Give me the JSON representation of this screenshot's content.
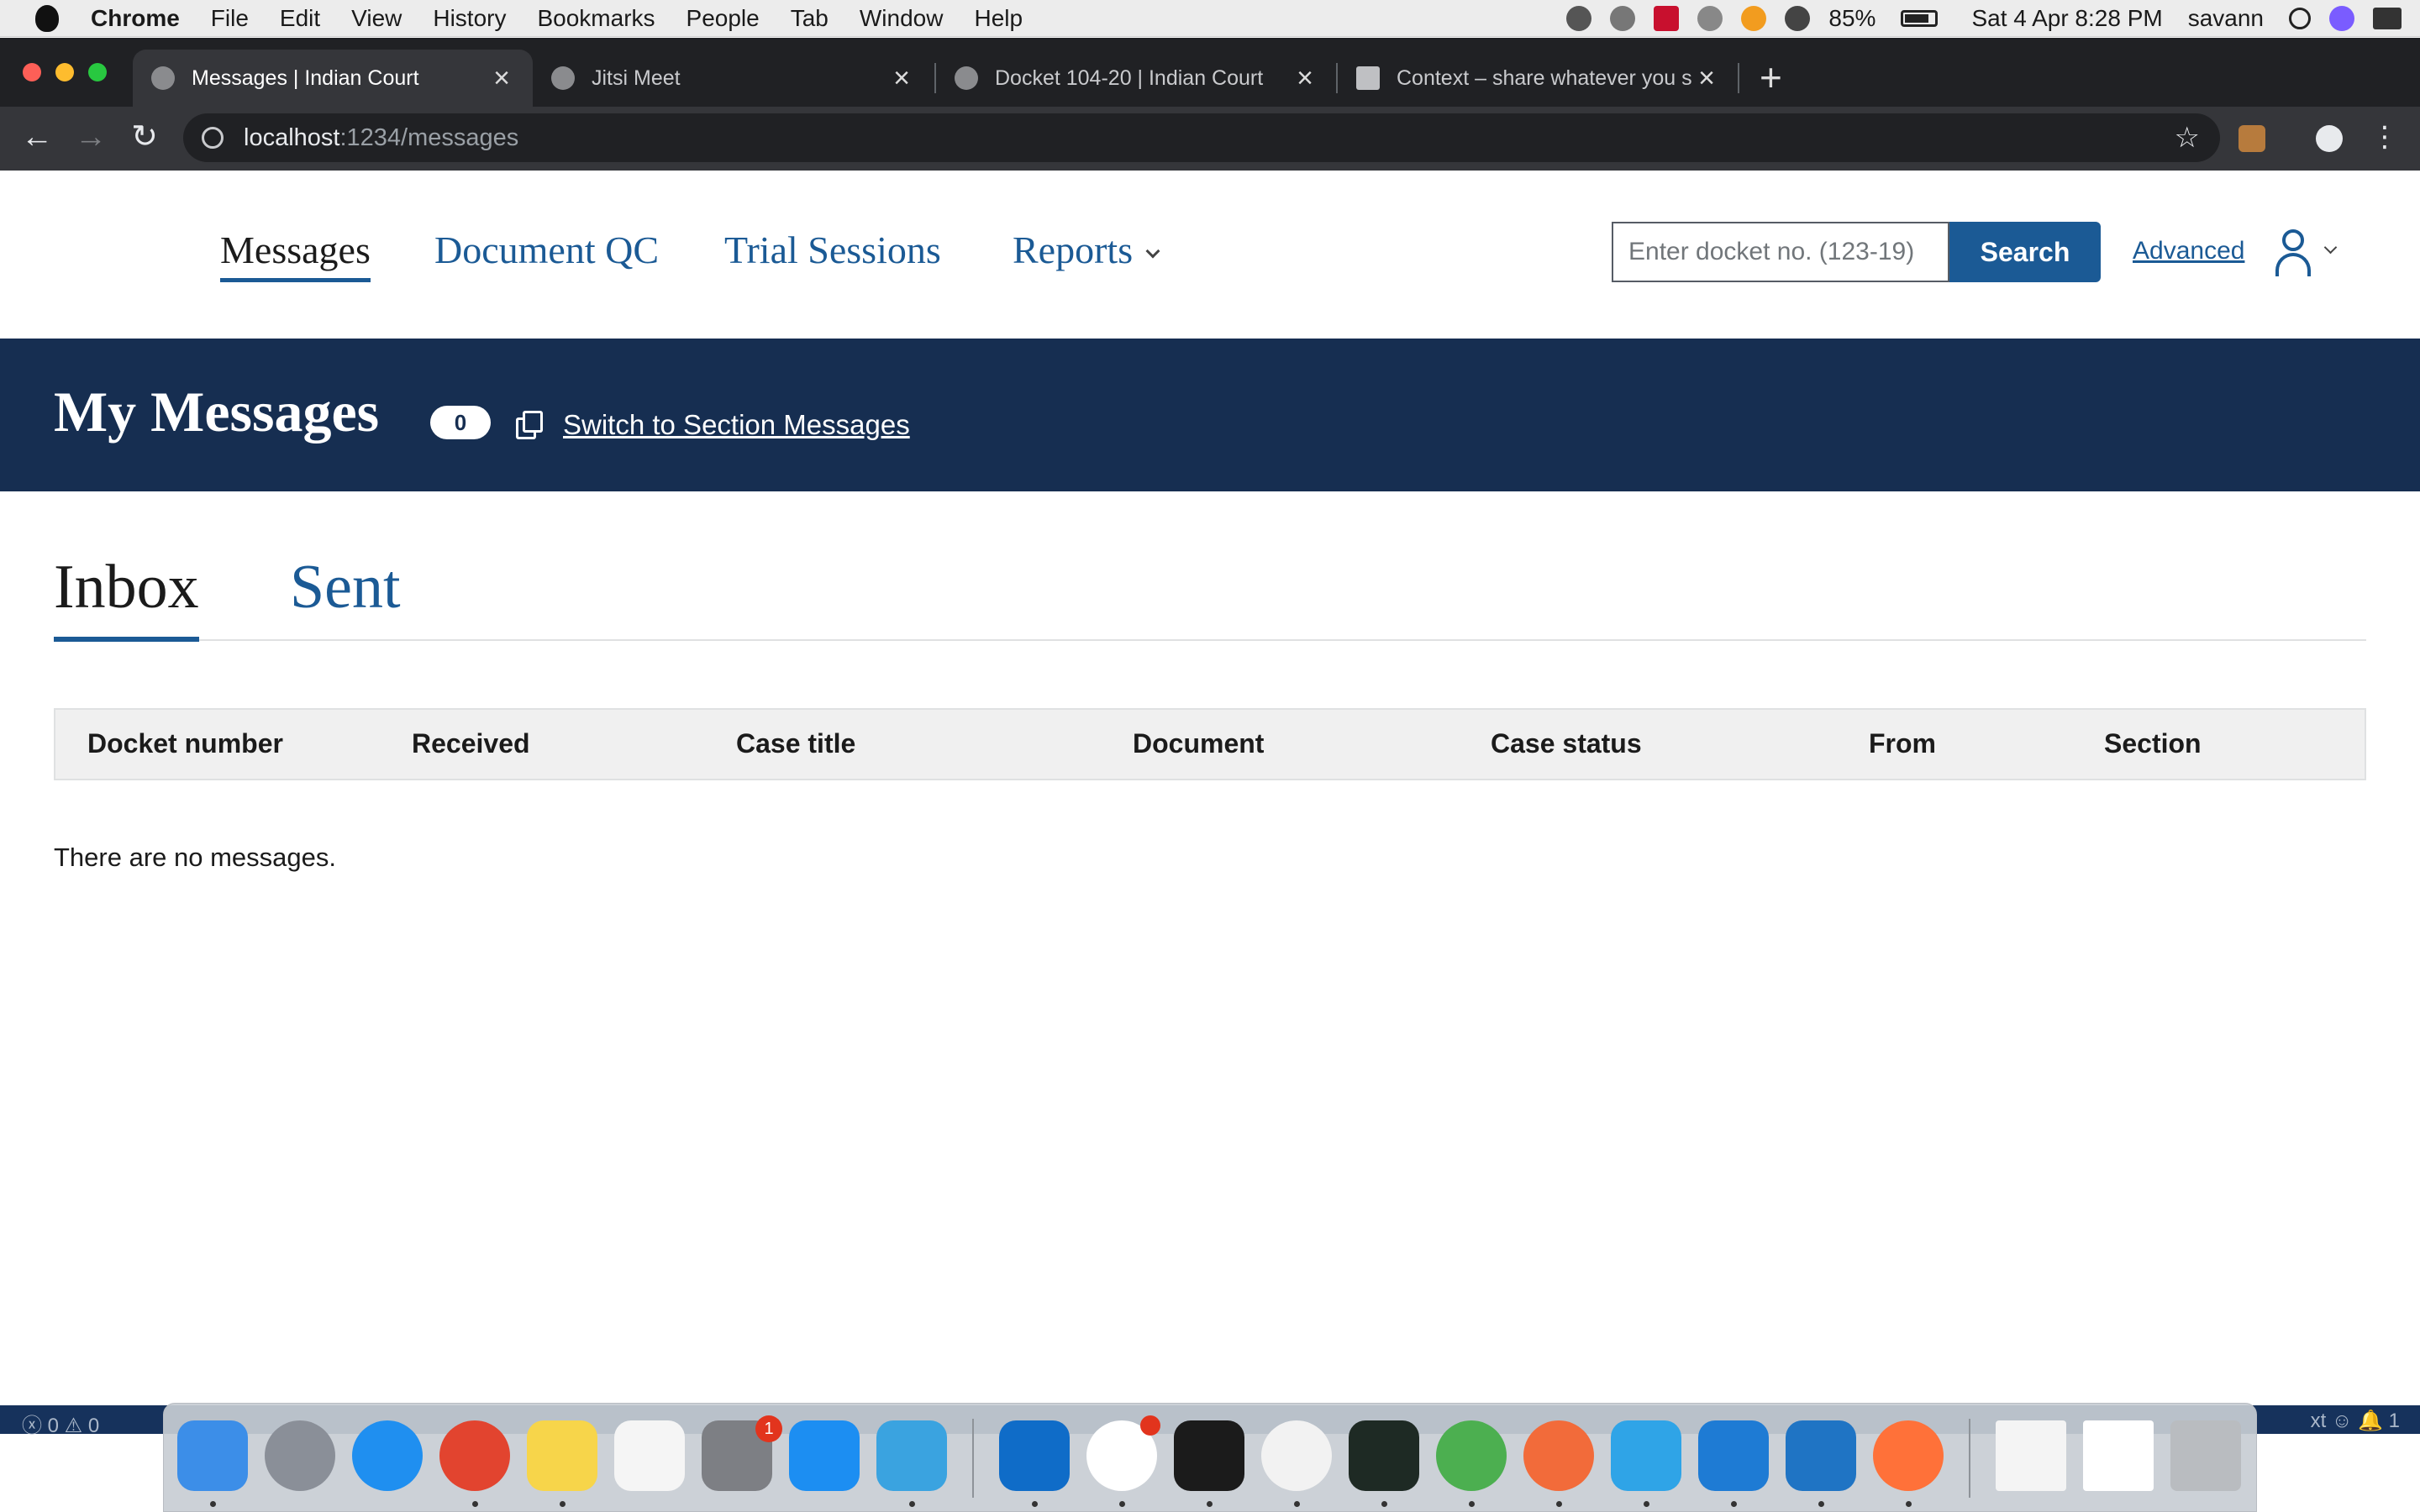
{
  "menubar": {
    "app_name": "Chrome",
    "items": [
      "File",
      "Edit",
      "View",
      "History",
      "Bookmarks",
      "People",
      "Tab",
      "Window",
      "Help"
    ],
    "battery": "85%",
    "datetime": "Sat 4 Apr  8:28 PM",
    "user": "savann"
  },
  "browser": {
    "tabs": [
      {
        "title": "Messages | Indian Court",
        "active": true
      },
      {
        "title": "Jitsi Meet",
        "active": false
      },
      {
        "title": "Docket 104-20 | Indian Court",
        "active": false
      },
      {
        "title": "Context – share whatever you s",
        "active": false
      }
    ],
    "url_host": "localhost",
    "url_path": ":1234/messages"
  },
  "header": {
    "nav": {
      "messages": "Messages",
      "document_qc": "Document QC",
      "trial_sessions": "Trial Sessions",
      "reports": "Reports"
    },
    "search_placeholder": "Enter docket no. (123-19)",
    "search_button": "Search",
    "advanced_link": "Advanced"
  },
  "banner": {
    "title": "My Messages",
    "count": "0",
    "switch_link": "Switch to Section Messages"
  },
  "tabs": {
    "inbox": "Inbox",
    "sent": "Sent"
  },
  "table": {
    "columns": [
      "Docket number",
      "Received",
      "Case title",
      "Document",
      "Case status",
      "From",
      "Section"
    ],
    "empty_message": "There are no messages."
  },
  "statusbar": {
    "left": "ⓧ 0 ⚠ 0",
    "right": "xt  ☺  🔔 1"
  },
  "dock": {
    "apps": [
      "finder-icon",
      "launchpad-icon",
      "safari-icon",
      "chrome-icon",
      "notes-icon",
      "reminders-icon",
      "system-preferences-icon",
      "app-store-icon",
      "mindmap-icon",
      "outlook-icon",
      "slack-icon",
      "terminal-icon",
      "sketchbook-icon",
      "activity-monitor-icon",
      "rocket-icon",
      "postman-icon",
      "deploy-icon",
      "vscode-icon",
      "bracket-icon",
      "firefox-icon",
      "document-icon",
      "screenshot-icon",
      "trash-icon"
    ],
    "system_preferences_badge": "1"
  }
}
